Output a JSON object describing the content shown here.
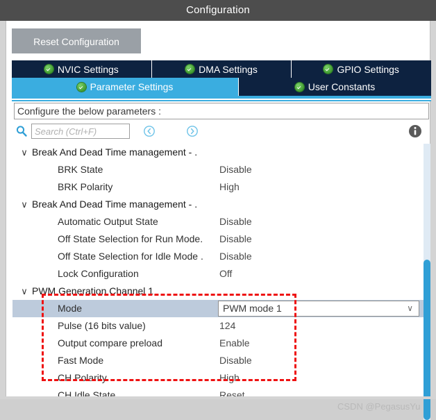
{
  "window": {
    "title": "Configuration"
  },
  "toolbar": {
    "reset_label": "Reset Configuration"
  },
  "tabs": {
    "row1": [
      {
        "label": "NVIC Settings",
        "icon": "check-circle-icon",
        "active": false
      },
      {
        "label": "DMA Settings",
        "icon": "check-circle-icon",
        "active": false
      },
      {
        "label": "GPIO Settings",
        "icon": "check-circle-icon",
        "active": false
      }
    ],
    "row2": [
      {
        "label": "Parameter Settings",
        "icon": "check-circle-icon",
        "active": true
      },
      {
        "label": "User Constants",
        "icon": "check-circle-icon",
        "active": false
      }
    ]
  },
  "header": {
    "configure_text": "Configure the below parameters :"
  },
  "search": {
    "placeholder": "Search (Ctrl+F)",
    "value": "",
    "prev_icon": "chevron-left-circle-icon",
    "next_icon": "chevron-right-circle-icon",
    "search_icon": "search-icon",
    "info_icon": "info-icon"
  },
  "tree": {
    "rows": [
      {
        "type": "group",
        "caret": "∨",
        "label": "Break And Dead Time management - .",
        "value": ""
      },
      {
        "type": "param",
        "label": "BRK State",
        "value": "Disable"
      },
      {
        "type": "param",
        "label": "BRK Polarity",
        "value": "High"
      },
      {
        "type": "group",
        "caret": "∨",
        "label": "Break And Dead Time management - .",
        "value": ""
      },
      {
        "type": "param",
        "label": "Automatic Output State",
        "value": "Disable"
      },
      {
        "type": "param",
        "label": "Off State Selection for Run Mode.",
        "value": "Disable"
      },
      {
        "type": "param",
        "label": "Off State Selection for Idle Mode .",
        "value": "Disable"
      },
      {
        "type": "param",
        "label": "Lock Configuration",
        "value": "Off"
      },
      {
        "type": "group",
        "caret": "∨",
        "label": "PWM Generation Channel 1",
        "value": ""
      },
      {
        "type": "combo",
        "label": "Mode",
        "value": "PWM mode 1",
        "selected": true,
        "arrow": "∨"
      },
      {
        "type": "param",
        "label": "Pulse (16 bits value)",
        "value": "124"
      },
      {
        "type": "param",
        "label": "Output compare preload",
        "value": "Enable"
      },
      {
        "type": "param",
        "label": "Fast Mode",
        "value": "Disable"
      },
      {
        "type": "param",
        "label": "CH Polarity",
        "value": "High"
      },
      {
        "type": "param",
        "label": "CH Idle State",
        "value": "Reset"
      }
    ]
  },
  "annotation": {
    "highlight_color": "#ee1111",
    "style": "dashed-rectangle"
  },
  "watermark": {
    "text": "CSDN @PegasusYu"
  },
  "colors": {
    "title_bar": "#4d4d4d",
    "tab_inactive": "#0d2240",
    "tab_active": "#3aade0",
    "accent": "#3aade0",
    "selection": "#bdcbdc",
    "scrollbar_thumb": "#2f9fd6"
  }
}
